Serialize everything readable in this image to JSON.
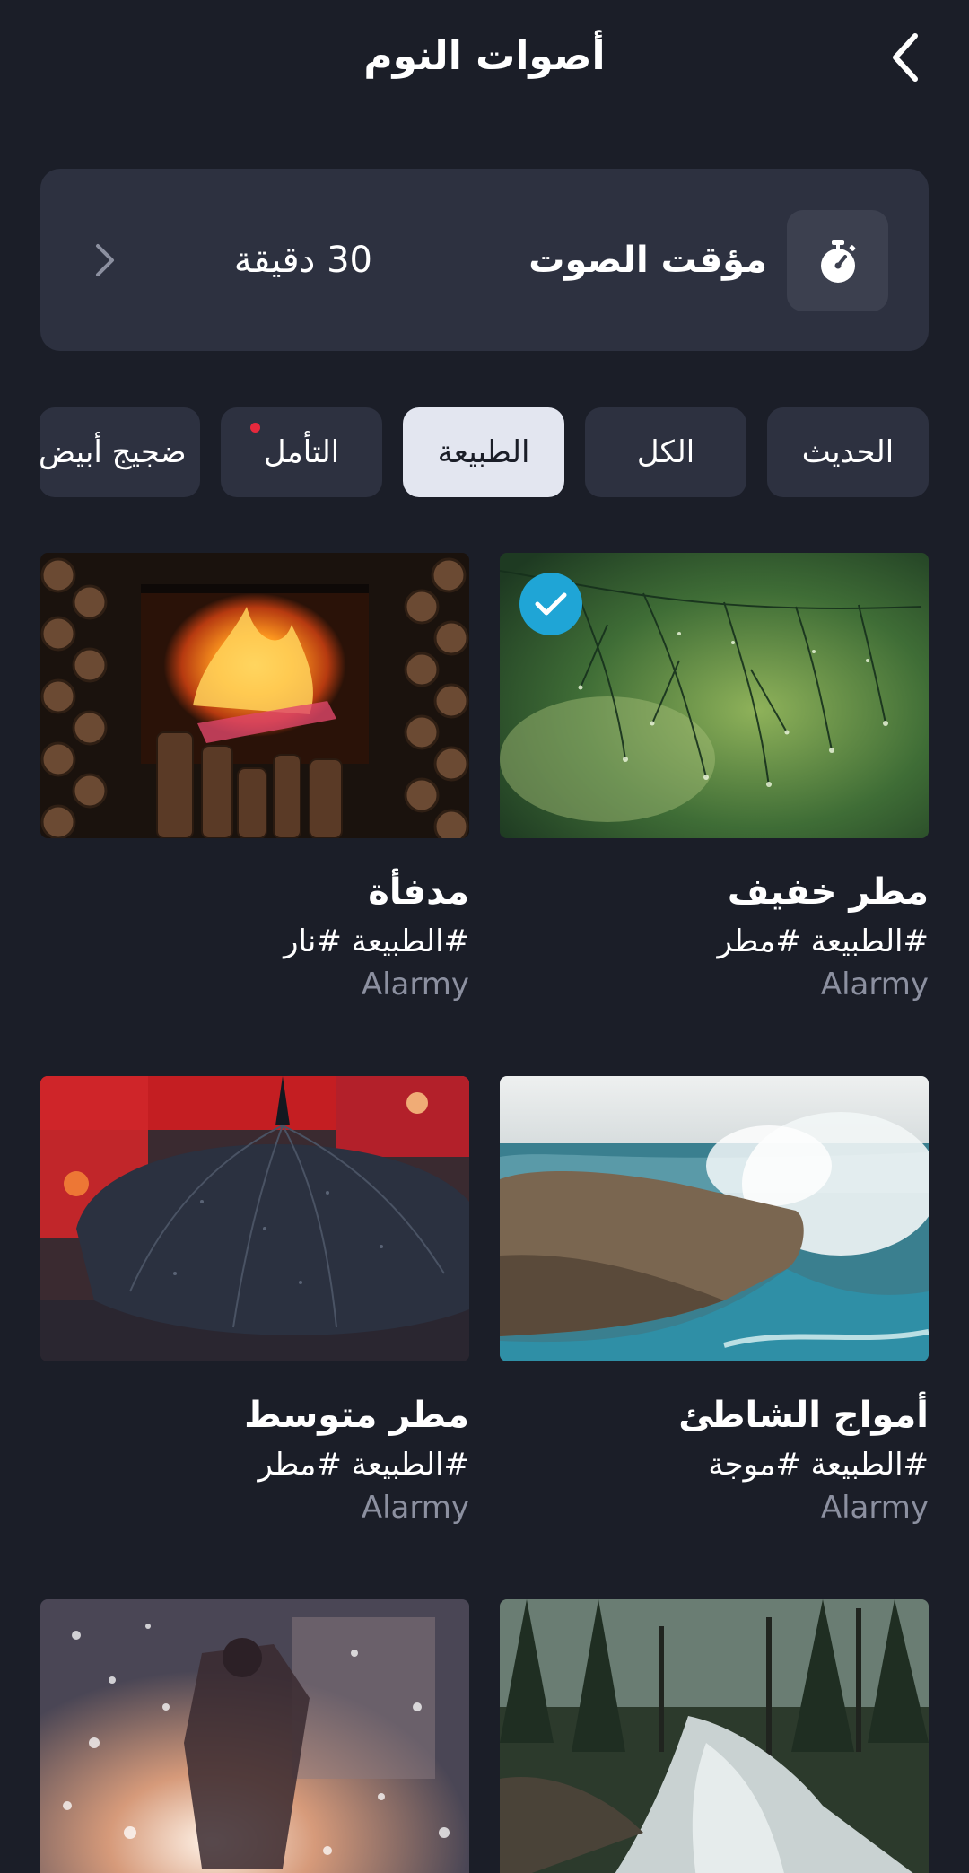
{
  "header": {
    "title": "أصوات النوم"
  },
  "timer": {
    "label": "مؤقت الصوت",
    "value": "30 دقيقة"
  },
  "tabs": [
    {
      "label": "الحديث"
    },
    {
      "label": "الكل"
    },
    {
      "label": "الطبيعة",
      "active": true
    },
    {
      "label": "التأمل",
      "badge": true
    },
    {
      "label": "ضجيج أبيض"
    }
  ],
  "sounds": [
    {
      "title": "مطر خفيف",
      "tags": "#الطبيعة #مطر",
      "author": "Alarmy",
      "selected": true
    },
    {
      "title": "مدفأة",
      "tags": "#الطبيعة #نار",
      "author": "Alarmy",
      "selected": false
    },
    {
      "title": "أمواج الشاطئ",
      "tags": "#الطبيعة #موجة",
      "author": "Alarmy",
      "selected": false
    },
    {
      "title": "مطر متوسط",
      "tags": "#الطبيعة #مطر",
      "author": "Alarmy",
      "selected": false
    },
    {
      "title": "",
      "tags": "",
      "author": ""
    },
    {
      "title": "",
      "tags": "",
      "author": ""
    }
  ],
  "colors": {
    "background": "#1b1e28",
    "card": "#2d3140",
    "active_tab": "#e3e6f0",
    "accent": "#1fa5d6",
    "badge": "#e6293d",
    "muted": "#8c90a0"
  },
  "icons": {
    "back": "chevron-left-icon",
    "timer": "stopwatch-icon",
    "timer_arrow": "chevron-right-icon",
    "selected": "check-icon"
  }
}
